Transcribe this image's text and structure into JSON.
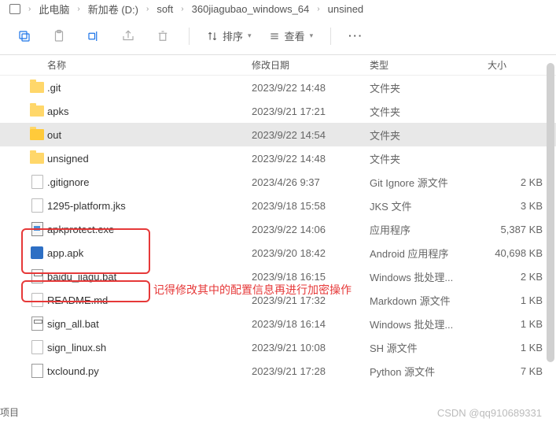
{
  "breadcrumb": [
    "此电脑",
    "新加卷 (D:)",
    "soft",
    "360jiagubao_windows_64",
    "unsined"
  ],
  "toolbar": {
    "sort": "排序",
    "view": "查看"
  },
  "columns": {
    "name": "名称",
    "date": "修改日期",
    "type": "类型",
    "size": "大小"
  },
  "files": [
    {
      "icon": "folder",
      "name": ".git",
      "date": "2023/9/22 14:48",
      "type": "文件夹",
      "size": ""
    },
    {
      "icon": "folder",
      "name": "apks",
      "date": "2023/9/21 17:21",
      "type": "文件夹",
      "size": ""
    },
    {
      "icon": "folder-open",
      "name": "out",
      "date": "2023/9/22 14:54",
      "type": "文件夹",
      "size": "",
      "selected": true
    },
    {
      "icon": "folder",
      "name": "unsigned",
      "date": "2023/9/22 14:48",
      "type": "文件夹",
      "size": ""
    },
    {
      "icon": "file",
      "name": ".gitignore",
      "date": "2023/4/26 9:37",
      "type": "Git Ignore 源文件",
      "size": "2 KB"
    },
    {
      "icon": "file",
      "name": "1295-platform.jks",
      "date": "2023/9/18 15:58",
      "type": "JKS 文件",
      "size": "3 KB"
    },
    {
      "icon": "exe",
      "name": "apkprotect.exe",
      "date": "2023/9/22 14:06",
      "type": "应用程序",
      "size": "5,387 KB"
    },
    {
      "icon": "apk",
      "name": "app.apk",
      "date": "2023/9/20 18:42",
      "type": "Android 应用程序",
      "size": "40,698 KB"
    },
    {
      "icon": "bat",
      "name": "baidu_jiagu.bat",
      "date": "2023/9/18 16:15",
      "type": "Windows 批处理...",
      "size": "2 KB"
    },
    {
      "icon": "file",
      "name": "README.md",
      "date": "2023/9/21 17:32",
      "type": "Markdown 源文件",
      "size": "1 KB"
    },
    {
      "icon": "bat",
      "name": "sign_all.bat",
      "date": "2023/9/18 16:14",
      "type": "Windows 批处理...",
      "size": "1 KB"
    },
    {
      "icon": "file",
      "name": "sign_linux.sh",
      "date": "2023/9/21 10:08",
      "type": "SH 源文件",
      "size": "1 KB"
    },
    {
      "icon": "py",
      "name": "txclound.py",
      "date": "2023/9/21 17:28",
      "type": "Python 源文件",
      "size": "7 KB"
    }
  ],
  "annotation": "记得修改其中的配置信息再进行加密操作",
  "footer_left": "项目",
  "watermark": "CSDN @qq910689331"
}
